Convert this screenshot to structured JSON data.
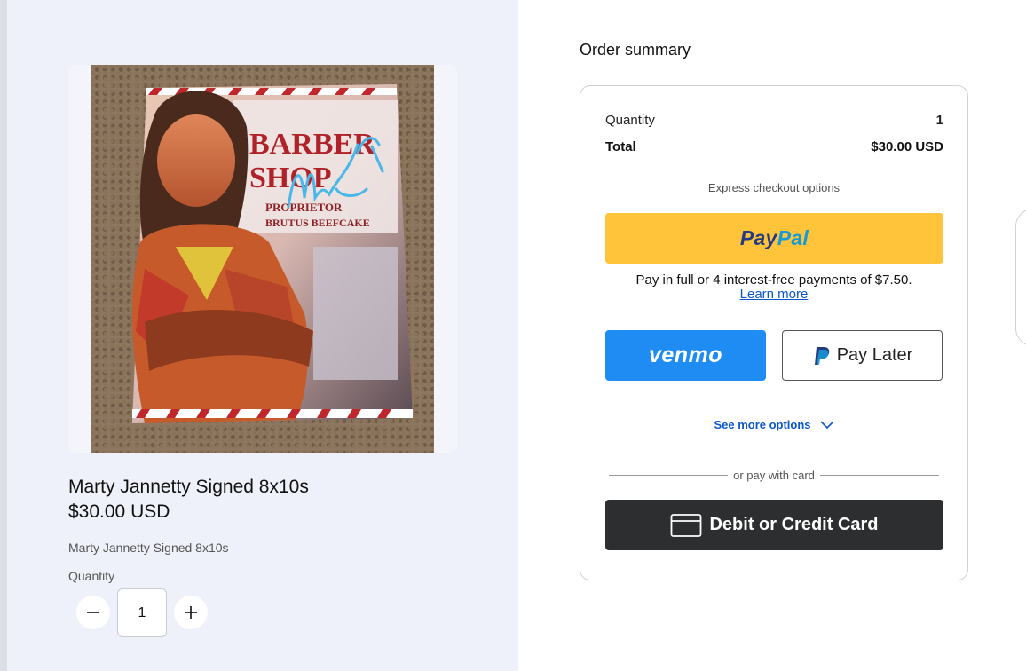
{
  "product": {
    "title": "Marty Jannetty Signed 8x10s",
    "price": "$30.00 USD",
    "description": "Marty Jannetty Signed 8x10s",
    "quantity_label": "Quantity",
    "quantity_value": "1",
    "image": {
      "poster_text_line1": "BARBER",
      "poster_text_line2": "SHOP",
      "poster_text_line3": "PROPRIETOR",
      "poster_text_line4": "BRUTUS BEEFCAKE",
      "signature": "Marty Jannetty"
    }
  },
  "summary": {
    "heading": "Order summary",
    "quantity_label": "Quantity",
    "quantity_value": "1",
    "total_label": "Total",
    "total_value": "$30.00 USD",
    "express_label": "Express checkout options",
    "paypal_pay": "Pay",
    "paypal_pal": "Pal",
    "payin_text": "Pay in full or 4 interest-free payments of $7.50.",
    "learn_more": "Learn more",
    "venmo_label": "venmo",
    "pay_later_label": "Pay Later",
    "see_more": "See more options",
    "divider_text": "or pay with card",
    "card_label": "Debit or Credit Card"
  },
  "colors": {
    "paypal_yellow": "#ffc43a",
    "venmo_blue": "#1e8cf2",
    "card_dark": "#2c2e2f",
    "link_blue": "#0b57c9",
    "left_panel_bg": "#eef1f9"
  },
  "icons": [
    "minus-icon",
    "plus-icon",
    "paypal-p-icon",
    "chevron-down-icon",
    "credit-card-icon"
  ]
}
